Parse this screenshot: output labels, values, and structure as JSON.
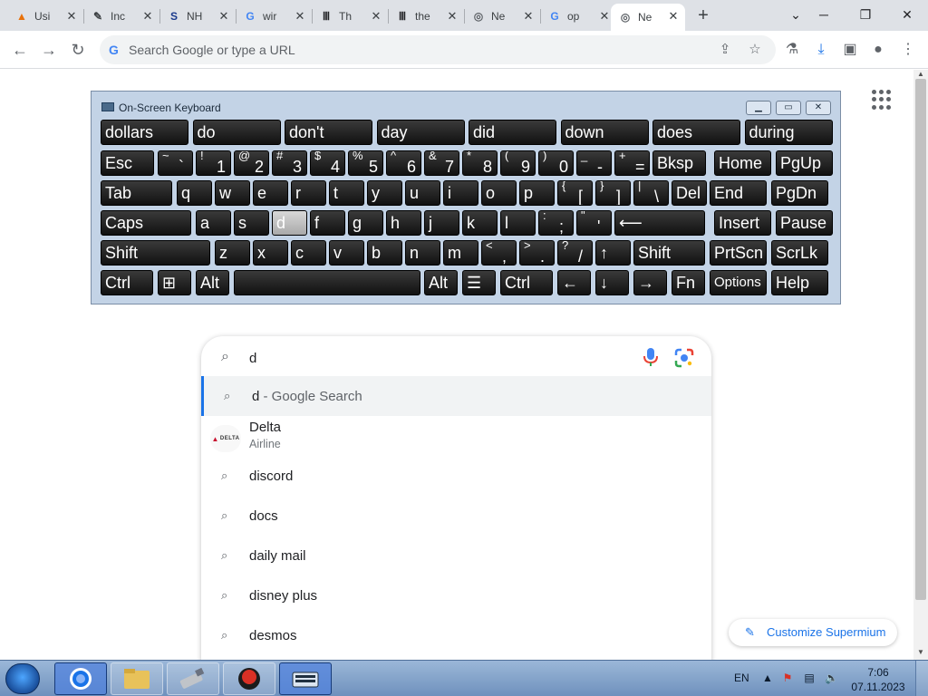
{
  "tabs": [
    {
      "icon": "vlc-icon",
      "glyph": "▲",
      "color": "#e8710a",
      "title": "Usi"
    },
    {
      "icon": "pen-icon",
      "glyph": "✎",
      "color": "#3c4043",
      "title": "Inc"
    },
    {
      "icon": "s-icon",
      "glyph": "S",
      "color": "#1a3a8c",
      "title": "NH"
    },
    {
      "icon": "google-icon",
      "glyph": "G",
      "color": "#4285f4",
      "title": "wir"
    },
    {
      "icon": "museum-icon",
      "glyph": "Ⅲ",
      "color": "#202124",
      "title": "Th"
    },
    {
      "icon": "museum-icon",
      "glyph": "Ⅲ",
      "color": "#202124",
      "title": "the"
    },
    {
      "icon": "chromium-icon",
      "glyph": "◎",
      "color": "#5f6368",
      "title": "Ne"
    },
    {
      "icon": "google-icon",
      "glyph": "G",
      "color": "#4285f4",
      "title": "op"
    },
    {
      "icon": "chromium-icon",
      "glyph": "◎",
      "color": "#5f6368",
      "title": "Ne"
    }
  ],
  "toolbar": {
    "omnibox_placeholder": "Search Google or type a URL"
  },
  "keyboard": {
    "title": "On-Screen Keyboard",
    "predictions": [
      "dollars",
      "do",
      "don't",
      "day",
      "did",
      "down",
      "does",
      "during"
    ],
    "row1": [
      {
        "l": "Esc"
      },
      {
        "sup": "~",
        "sub": "`"
      },
      {
        "sup": "!",
        "sub": "1"
      },
      {
        "sup": "@",
        "sub": "2"
      },
      {
        "sup": "#",
        "sub": "3"
      },
      {
        "sup": "$",
        "sub": "4"
      },
      {
        "sup": "%",
        "sub": "5"
      },
      {
        "sup": "^",
        "sub": "6"
      },
      {
        "sup": "&",
        "sub": "7"
      },
      {
        "sup": "*",
        "sub": "8"
      },
      {
        "sup": "(",
        "sub": "9"
      },
      {
        "sup": ")",
        "sub": "0"
      },
      {
        "sup": "_",
        "sub": "-"
      },
      {
        "sup": "+",
        "sub": "="
      },
      {
        "l": "Bksp"
      },
      {
        "l": "Home"
      },
      {
        "l": "PgUp"
      }
    ],
    "row2": [
      {
        "l": "Tab"
      },
      {
        "l": "q"
      },
      {
        "l": "w"
      },
      {
        "l": "e"
      },
      {
        "l": "r"
      },
      {
        "l": "t"
      },
      {
        "l": "y"
      },
      {
        "l": "u"
      },
      {
        "l": "i"
      },
      {
        "l": "o"
      },
      {
        "l": "p"
      },
      {
        "sup": "{",
        "sub": "["
      },
      {
        "sup": "}",
        "sub": "]"
      },
      {
        "sup": "|",
        "sub": "\\"
      },
      {
        "l": "Del"
      },
      {
        "l": "End"
      },
      {
        "l": "PgDn"
      }
    ],
    "row3": [
      {
        "l": "Caps"
      },
      {
        "l": "a"
      },
      {
        "l": "s"
      },
      {
        "l": "d"
      },
      {
        "l": "f"
      },
      {
        "l": "g"
      },
      {
        "l": "h"
      },
      {
        "l": "j"
      },
      {
        "l": "k"
      },
      {
        "l": "l"
      },
      {
        "sup": ":",
        "sub": ";"
      },
      {
        "sup": "\"",
        "sub": "'"
      },
      {
        "l": "⟵"
      },
      {
        "l": "Insert"
      },
      {
        "l": "Pause"
      }
    ],
    "row4": [
      {
        "l": "Shift"
      },
      {
        "l": "z"
      },
      {
        "l": "x"
      },
      {
        "l": "c"
      },
      {
        "l": "v"
      },
      {
        "l": "b"
      },
      {
        "l": "n"
      },
      {
        "l": "m"
      },
      {
        "sup": "<",
        "sub": ","
      },
      {
        "sup": ">",
        "sub": "."
      },
      {
        "sup": "?",
        "sub": "/"
      },
      {
        "l": "↑"
      },
      {
        "l": "Shift"
      },
      {
        "l": "PrtScn"
      },
      {
        "l": "ScrLk"
      }
    ],
    "row5": [
      {
        "l": "Ctrl"
      },
      {
        "l": "⊞"
      },
      {
        "l": "Alt"
      },
      {
        "l": ""
      },
      {
        "l": "Alt"
      },
      {
        "l": "☰"
      },
      {
        "l": "Ctrl"
      },
      {
        "l": "←"
      },
      {
        "l": "↓"
      },
      {
        "l": "→"
      },
      {
        "l": "Fn"
      },
      {
        "l": "Options"
      },
      {
        "l": "Help"
      }
    ],
    "pressed_key": "d"
  },
  "search": {
    "query": "d",
    "suggestions": [
      {
        "text": "d",
        "rest": " - Google Search"
      },
      {
        "text": "Delta",
        "sub": "Airline",
        "logo": "DELTA"
      },
      {
        "text": "discord"
      },
      {
        "text": "docs"
      },
      {
        "text": "daily mail"
      },
      {
        "text": "disney plus"
      },
      {
        "text": "desmos"
      }
    ]
  },
  "customize_label": "Customize Supermium",
  "taskbar": {
    "lang": "EN",
    "time": "7:06",
    "date": "07.11.2023"
  },
  "colors": {
    "accent": "#1a73e8",
    "tabstrip": "#dee1e6",
    "taskbar": "#7f9fc8"
  }
}
